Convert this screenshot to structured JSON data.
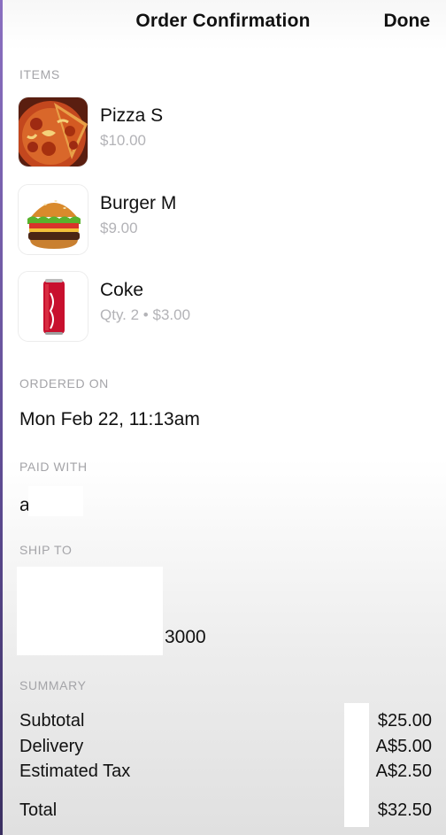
{
  "nav": {
    "title": "Order Confirmation",
    "done_label": "Done"
  },
  "items_section": {
    "header": "ITEMS",
    "items": [
      {
        "name": "Pizza S",
        "price": "$10.00",
        "qty": "",
        "icon": "pizza-image"
      },
      {
        "name": "Burger M",
        "price": "$9.00",
        "qty": "",
        "icon": "burger-image"
      },
      {
        "name": "Coke",
        "price": "$3.00",
        "qty": "Qty. 2 • ",
        "icon": "coke-can-image"
      }
    ]
  },
  "ordered_on": {
    "header": "ORDERED ON",
    "value": "Mon Feb 22, 11:13am"
  },
  "paid_with": {
    "header": "PAID WITH",
    "value": "a"
  },
  "ship_to": {
    "header": "SHIP TO",
    "value": "3000"
  },
  "summary": {
    "header": "SUMMARY",
    "rows": [
      {
        "label": "Subtotal",
        "amount": "$25.00"
      },
      {
        "label": "Delivery",
        "amount": "A$5.00"
      },
      {
        "label": "Estimated Tax",
        "amount": "A$2.50"
      },
      {
        "label": "Total",
        "amount": "$32.50"
      }
    ]
  },
  "colors": {
    "section_header": "#a4a4a8",
    "secondary_text": "#b3b3b7",
    "primary_text": "#111111"
  }
}
